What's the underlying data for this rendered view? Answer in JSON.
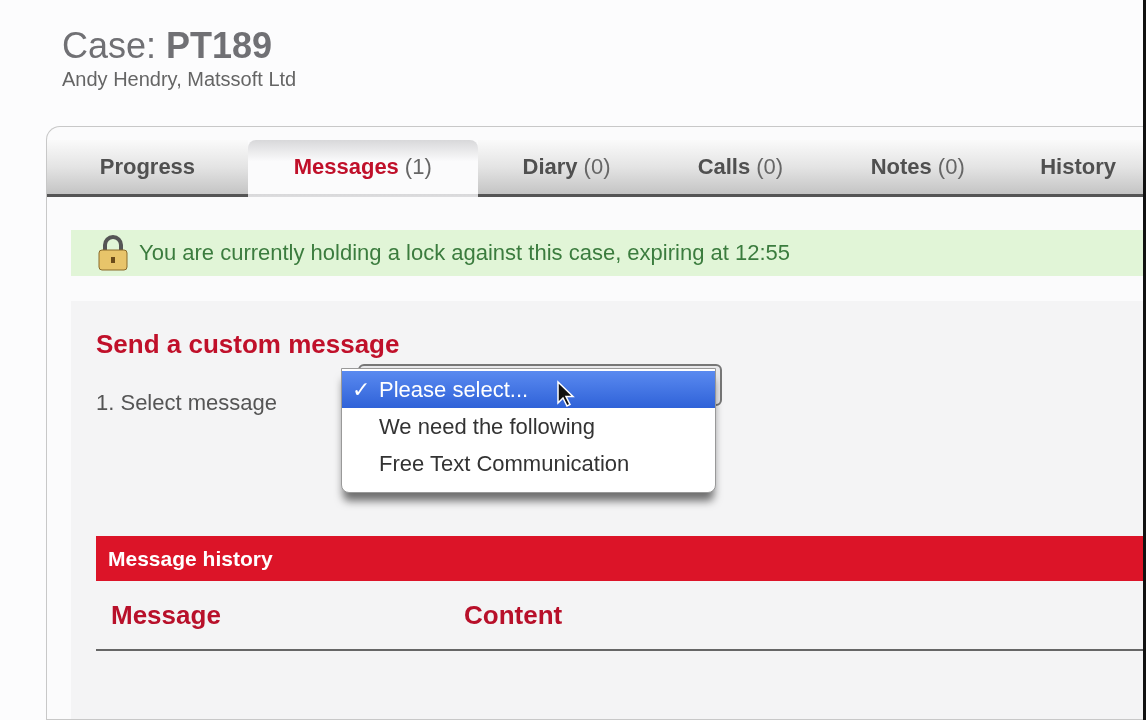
{
  "case": {
    "label": "Case:",
    "id": "PT189",
    "subtitle": "Andy Hendry, Matssoft Ltd"
  },
  "tabs": [
    {
      "label": "Progress",
      "selected": false
    },
    {
      "label": "Messages",
      "count": "(1)",
      "selected": true
    },
    {
      "label": "Diary",
      "count": "(0)",
      "selected": false
    },
    {
      "label": "Calls",
      "count": "(0)",
      "selected": false
    },
    {
      "label": "Notes",
      "count": "(0)",
      "selected": false
    },
    {
      "label": "History",
      "selected": false
    }
  ],
  "lock_banner": {
    "text": "You are currently holding a lock against this case, expiring at 12:55"
  },
  "custom_message": {
    "heading": "Send a custom message",
    "select_label": "1. Select message",
    "options": [
      {
        "label": "Please select...",
        "check": "✓",
        "selected": true
      },
      {
        "label": "We need the following",
        "selected": false
      },
      {
        "label": "Free Text Communication",
        "selected": false
      }
    ]
  },
  "message_history": {
    "title": "Message history",
    "columns": [
      "Message",
      "Content"
    ]
  }
}
